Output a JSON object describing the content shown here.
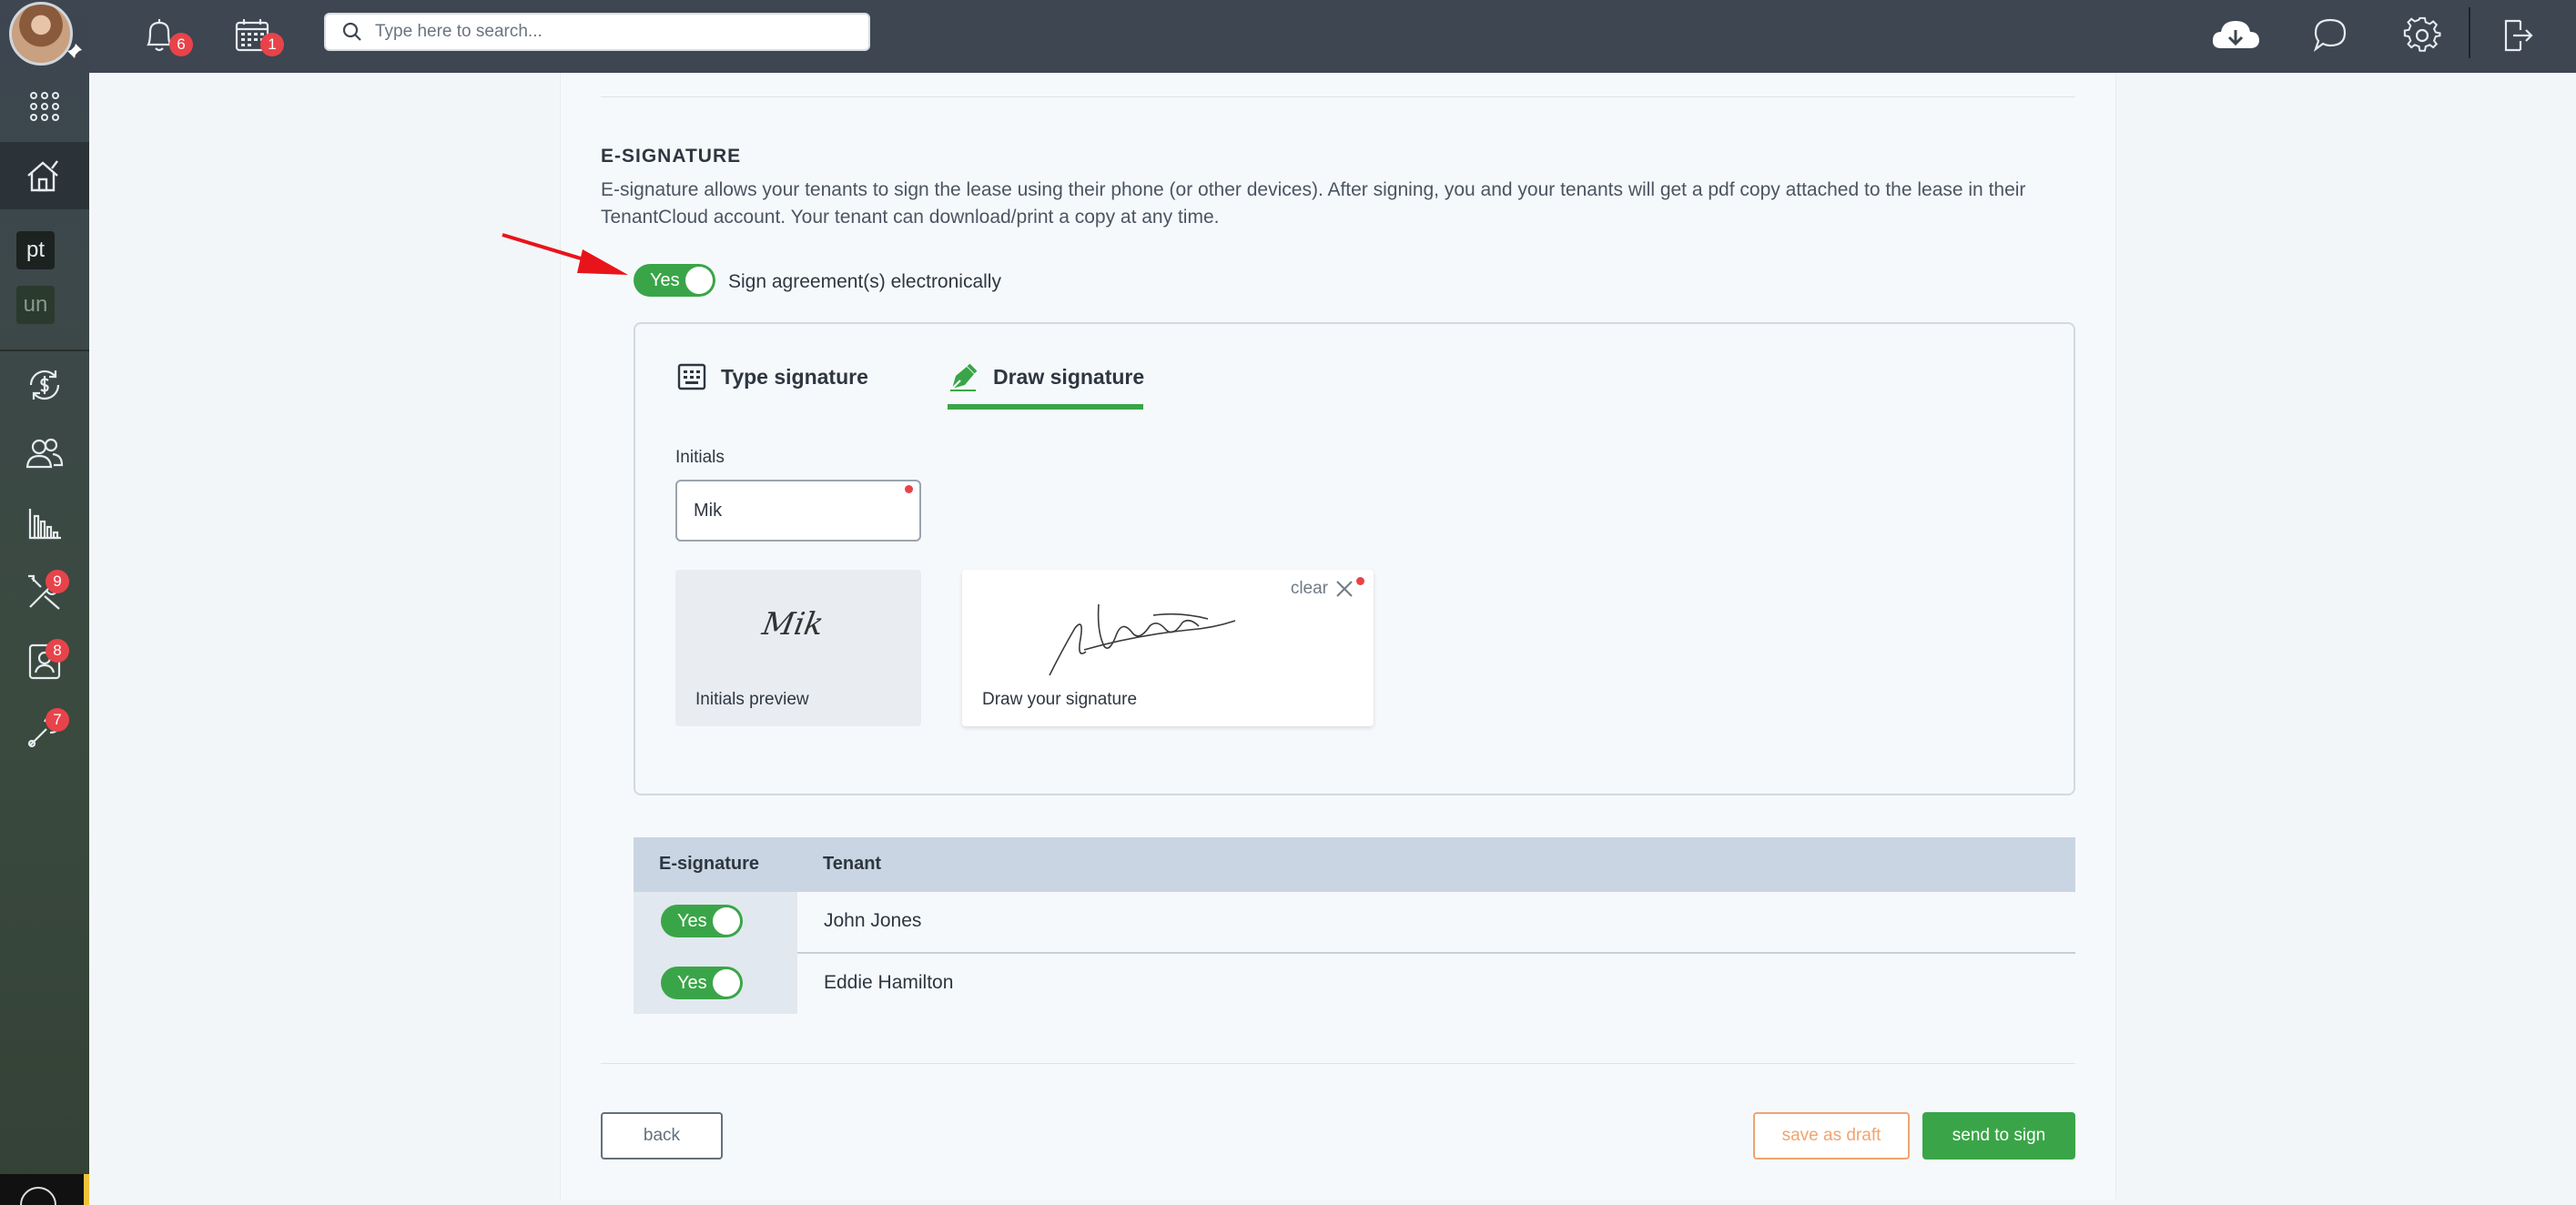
{
  "topbar": {
    "notifications_count": "6",
    "calendar_count": "1",
    "search_placeholder": "Type here to search..."
  },
  "sidebar": {
    "box1": "pt",
    "box2": "un",
    "maintenance_count": "9",
    "applications_count": "8",
    "tools_count": "7"
  },
  "esignature": {
    "title": "E-SIGNATURE",
    "description": "E-signature allows your tenants to sign the lease using their phone (or other devices). After signing, you and your tenants will get a pdf copy attached to the lease in their TenantCloud account. Your tenant can download/print a copy at any time.",
    "toggle_label": "Yes",
    "toggle_text": "Sign agreement(s) electronically",
    "tabs": [
      {
        "label": "Type signature"
      },
      {
        "label": "Draw signature",
        "active": true
      }
    ],
    "initials_label": "Initials",
    "initials_value": "Mik",
    "initials_preview_text": "Mik",
    "initials_preview_caption": "Initials preview",
    "draw_caption": "Draw your signature",
    "clear_label": "clear"
  },
  "table": {
    "headers": [
      "E-signature",
      "Tenant"
    ],
    "rows": [
      {
        "toggle": "Yes",
        "tenant": "John Jones"
      },
      {
        "toggle": "Yes",
        "tenant": "Eddie Hamilton"
      }
    ]
  },
  "buttons": {
    "back": "back",
    "save_draft": "save as draft",
    "send": "send to sign"
  },
  "colors": {
    "topbar": "#3d4651",
    "accent_green": "#3aa548",
    "badge_red": "#e8434a",
    "draft_orange": "#f0a470"
  }
}
